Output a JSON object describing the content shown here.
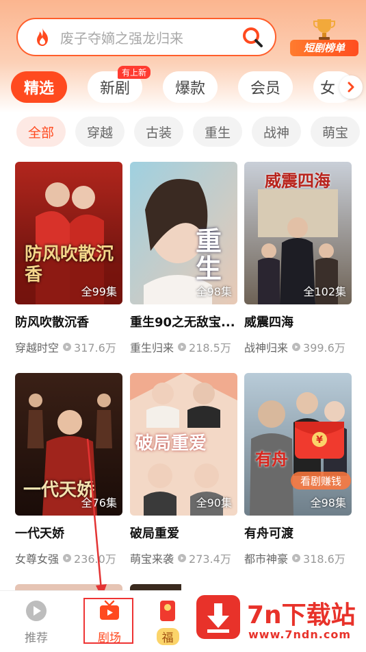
{
  "search": {
    "placeholder": "废子夺嫡之强龙归来"
  },
  "rank_badge": {
    "label": "短剧榜单"
  },
  "tabs": [
    {
      "label": "精选",
      "active": true
    },
    {
      "label": "新剧",
      "badge": "有上新"
    },
    {
      "label": "爆款"
    },
    {
      "label": "会员"
    },
    {
      "label": "女"
    }
  ],
  "filters": [
    {
      "label": "全部",
      "active": true
    },
    {
      "label": "穿越"
    },
    {
      "label": "古装"
    },
    {
      "label": "重生"
    },
    {
      "label": "战神"
    },
    {
      "label": "萌宝"
    }
  ],
  "dramas": [
    {
      "title": "防风吹散沉香",
      "genre": "穿越时空",
      "views": "317.6万",
      "episodes": "全99集",
      "poster_text": "防风吹散沉香"
    },
    {
      "title": "重生90之无敌宝...",
      "genre": "重生归来",
      "views": "218.5万",
      "episodes": "全98集",
      "poster_text": "重生"
    },
    {
      "title": "威震四海",
      "genre": "战神归来",
      "views": "399.6万",
      "episodes": "全102集",
      "poster_text": "威震四海"
    },
    {
      "title": "一代天娇",
      "genre": "女尊女强",
      "views": "236.0万",
      "episodes": "全76集",
      "poster_text": "一代天娇"
    },
    {
      "title": "破局重爱",
      "genre": "萌宝来袭",
      "views": "273.4万",
      "episodes": "全90集",
      "poster_text": "破局重爱"
    },
    {
      "title": "有舟可渡",
      "genre": "都市神豪",
      "views": "318.6万",
      "episodes": "全98集",
      "poster_text": "有舟"
    }
  ],
  "earn_pill": "看剧赚钱",
  "bottom_nav": [
    {
      "label": "推荐"
    },
    {
      "label": "剧场",
      "active": true
    },
    {
      "label": "福"
    }
  ],
  "watermark": {
    "title": "7n下载站",
    "url": "www.7ndn.com"
  },
  "colors": {
    "accent": "#ff4a1f",
    "header_top": "#fbb58f",
    "annotation": "#e33333"
  }
}
